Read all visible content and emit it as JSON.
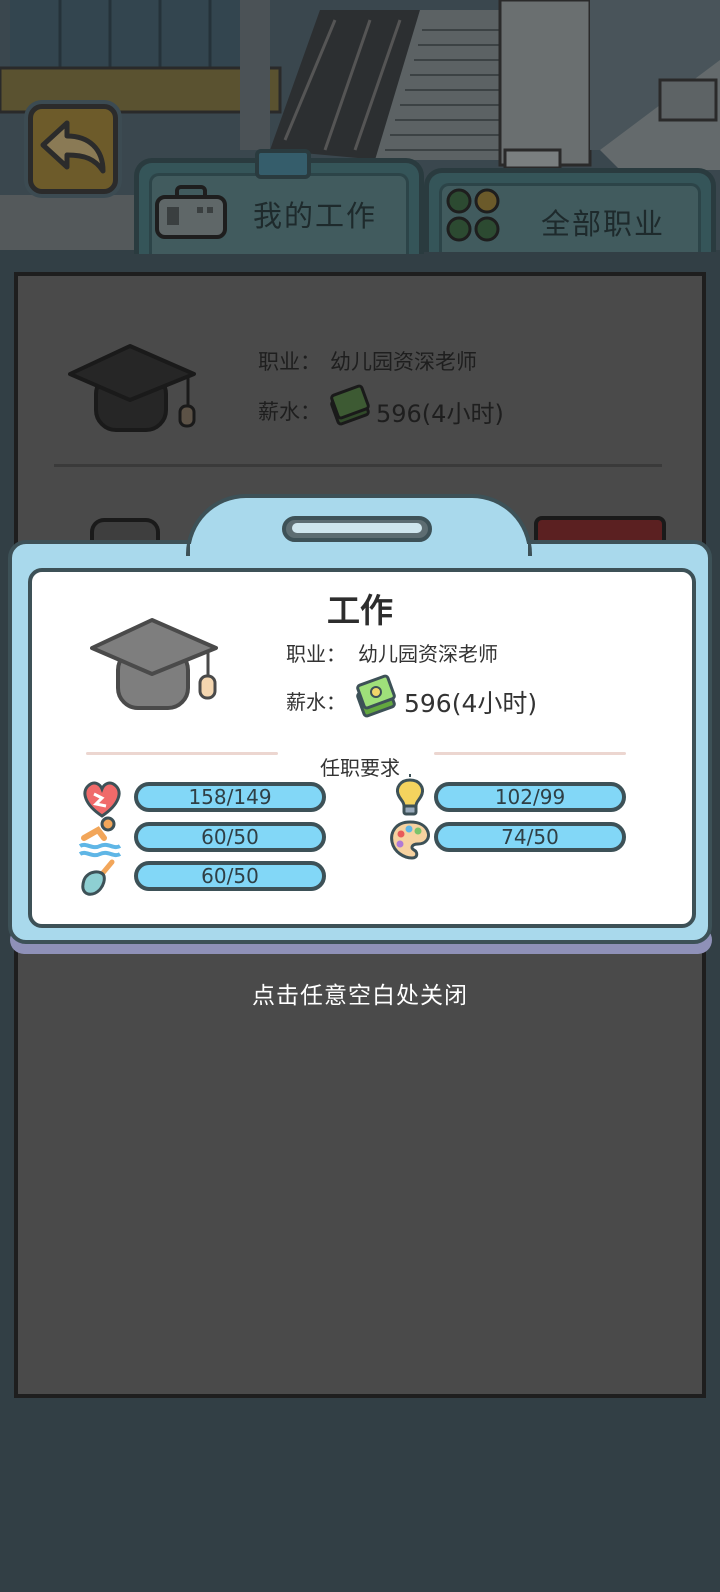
{
  "tabs": {
    "my_job": "我的工作",
    "all_jobs": "全部职业"
  },
  "background_job": {
    "occupation_label": "职业：",
    "occupation_value": "幼儿园资深老师",
    "salary_label": "薪水：",
    "salary_value": "596(4小时)"
  },
  "modal": {
    "title": "工作",
    "occupation_label": "职业：",
    "occupation_value": "幼儿园资深老师",
    "salary_label": "薪水：",
    "salary_value": "596(4小时)",
    "requirements_title": "任职要求",
    "stats": [
      {
        "icon": "heart-icon",
        "value": "158/149"
      },
      {
        "icon": "lightbulb-icon",
        "value": "102/99"
      },
      {
        "icon": "swimmer-icon",
        "value": "60/50"
      },
      {
        "icon": "palette-icon",
        "value": "74/50"
      },
      {
        "icon": "shovel-icon",
        "value": "60/50"
      }
    ]
  },
  "hint": "点击任意空白处关闭",
  "colors": {
    "modal_frame": "#a9d9ec",
    "stat_bar": "#82d7f7",
    "background": "#323f45"
  }
}
